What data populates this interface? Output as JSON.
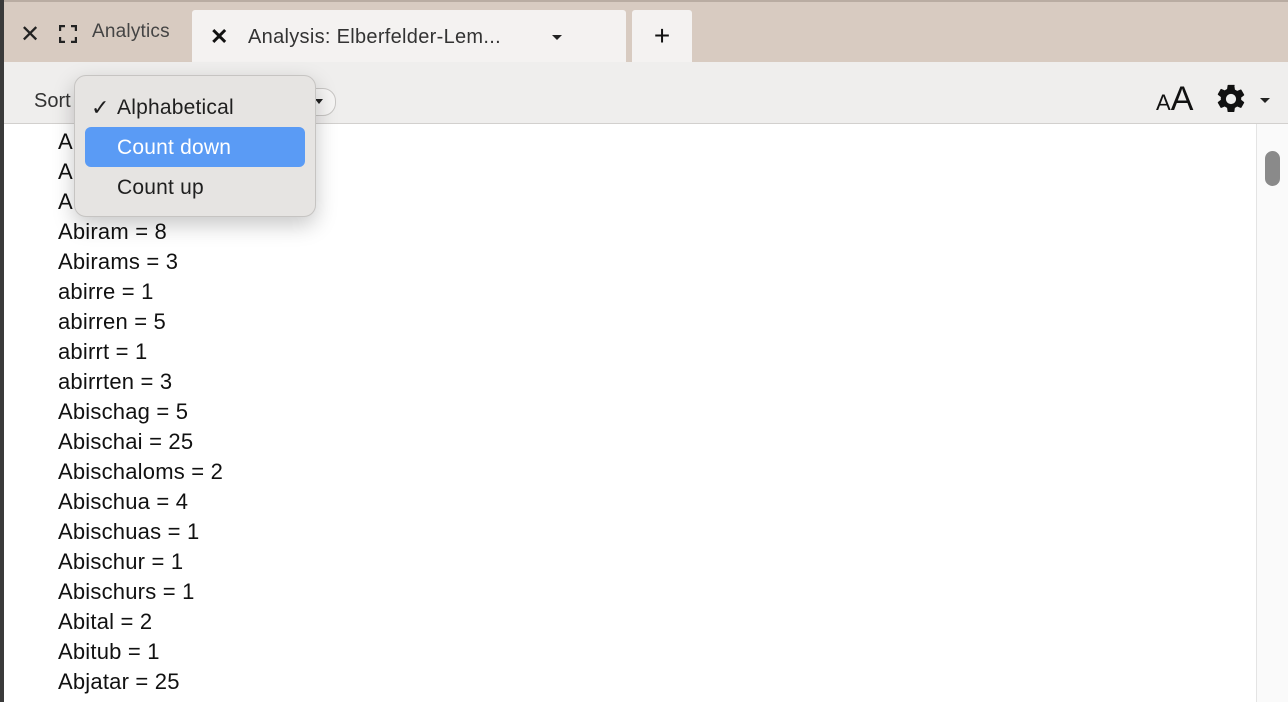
{
  "tabbar": {
    "panel_label": "Analytics",
    "active_tab_title": "Analysis: Elberfelder-Lem...",
    "add_tab_label": "+"
  },
  "toolbar": {
    "sort_label": "Sort",
    "font_small": "A",
    "font_large": "A"
  },
  "sort_menu": {
    "options": [
      {
        "label": "Alphabetical",
        "checked": true,
        "highlighted": false
      },
      {
        "label": "Count down",
        "checked": false,
        "highlighted": true
      },
      {
        "label": "Count up",
        "checked": false,
        "highlighted": false
      }
    ]
  },
  "word_counts": {
    "items": [
      "A",
      "A",
      "A",
      "Abiram = 8",
      "Abirams = 3",
      "abirre = 1",
      "abirren = 5",
      "abirrt = 1",
      "abirrten = 3",
      "Abischag = 5",
      "Abischai = 25",
      "Abischaloms = 2",
      "Abischua = 4",
      "Abischuas = 1",
      "Abischur = 1",
      "Abischurs = 1",
      "Abital = 2",
      "Abitub = 1",
      "Abjatar = 25"
    ]
  },
  "colors": {
    "highlight": "#5a9bf5",
    "tabbar_bg": "#d8cbc1",
    "toolbar_bg": "#efeeed"
  },
  "icons": [
    "close-icon",
    "fullscreen-icon",
    "chevron-down-icon",
    "plus-icon",
    "font-size-icon",
    "gear-icon",
    "checkmark-icon"
  ]
}
